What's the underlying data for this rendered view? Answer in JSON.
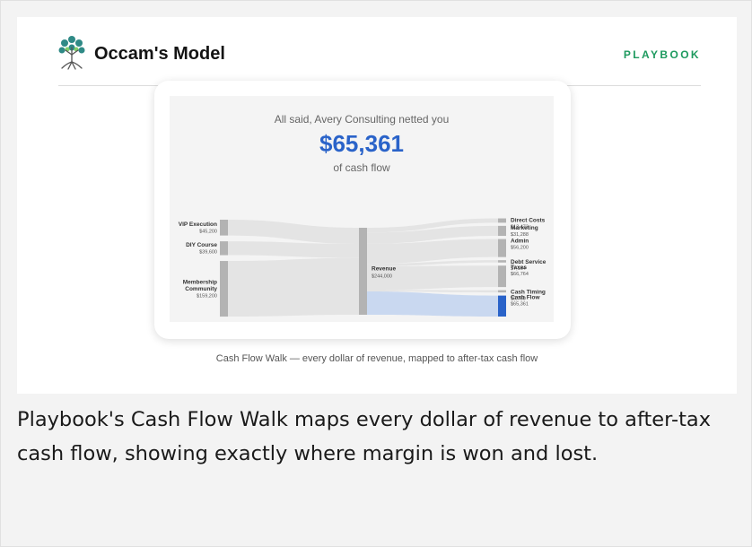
{
  "header": {
    "brand": "Occam's Model",
    "nav_link": "PLAYBOOK",
    "accent": "#1e9a5f"
  },
  "figure": {
    "lead": "All said, Avery Consulting netted you",
    "amount": "$65,361",
    "amount_color": "#2a63c9",
    "after": "of cash flow",
    "caption": "Cash Flow Walk — every dollar of revenue, mapped to after-tax cash flow"
  },
  "chart_data": {
    "type": "sankey",
    "sources": [
      {
        "name": "VIP Execution",
        "value_label": "$45,200",
        "value": 45200
      },
      {
        "name": "DIY Course",
        "value_label": "$39,600",
        "value": 39600
      },
      {
        "name": "Membership Community",
        "value_label": "$159,200",
        "value": 159200
      }
    ],
    "hub": {
      "name": "Revenue",
      "value_label": "$244,000",
      "value": 244000
    },
    "targets": [
      {
        "name": "Direct Costs",
        "value_label": "$13,473",
        "value": 13473
      },
      {
        "name": "Marketing",
        "value_label": "$31,288",
        "value": 31288
      },
      {
        "name": "Admin",
        "value_label": "$56,200",
        "value": 56200
      },
      {
        "name": "Debt Service",
        "value_label": "$7,164",
        "value": 7164
      },
      {
        "name": "Taxes",
        "value_label": "$66,764",
        "value": 66764
      },
      {
        "name": "Cash Timing",
        "value_label": "$3,750",
        "value": 3750
      },
      {
        "name": "Cash Flow",
        "value_label": "$65,361",
        "value": 65361,
        "highlight": true
      }
    ],
    "colors": {
      "node": "#b3b3b3",
      "link": "#e4e4e4",
      "highlight_node": "#2a63c9",
      "highlight_link": "#c9d8f0"
    }
  },
  "body": {
    "text": "Playbook's Cash Flow Walk maps every dollar of revenue to after-tax cash flow, showing exactly where margin is won and lost."
  }
}
